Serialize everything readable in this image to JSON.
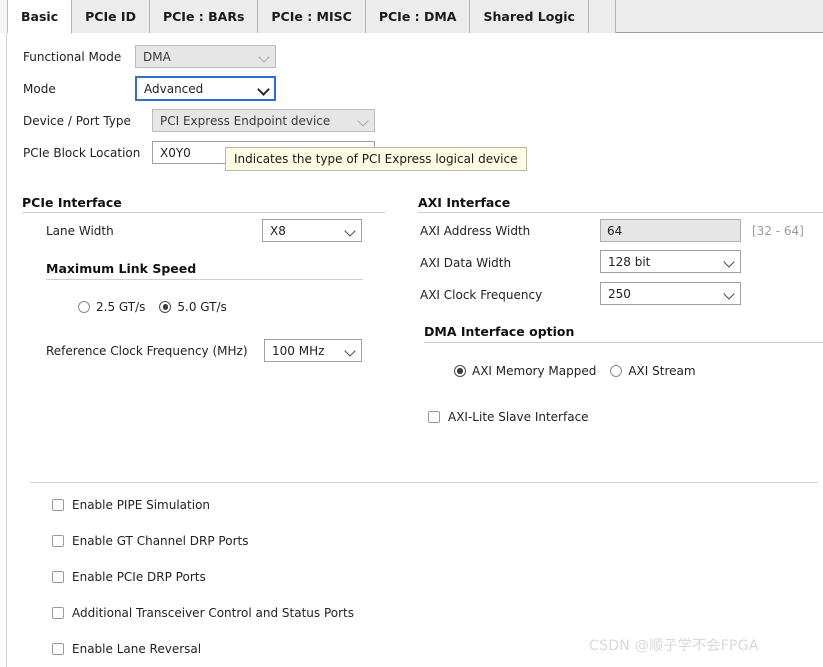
{
  "tabs": [
    {
      "label": "Basic",
      "active": true
    },
    {
      "label": "PCIe ID",
      "active": false
    },
    {
      "label": "PCIe : BARs",
      "active": false
    },
    {
      "label": "PCIe : MISC",
      "active": false
    },
    {
      "label": "PCIe : DMA",
      "active": false
    },
    {
      "label": "Shared Logic",
      "active": false
    }
  ],
  "top_form": {
    "functional_mode": {
      "label": "Functional Mode",
      "value": "DMA",
      "state": "disabled"
    },
    "mode": {
      "label": "Mode",
      "value": "Advanced",
      "state": "focused"
    },
    "device_port_type": {
      "label": "Device / Port Type",
      "value": "PCI Express Endpoint device",
      "state": "disabled"
    },
    "pcie_block_location": {
      "label": "PCIe Block Location",
      "value": "X0Y0",
      "state": "normal"
    }
  },
  "tooltip": {
    "text": "Indicates the type of PCI Express logical device"
  },
  "pcie_interface": {
    "title": "PCIe Interface",
    "lane_width": {
      "label": "Lane Width",
      "value": "X8"
    },
    "max_link_speed": {
      "title": "Maximum Link Speed",
      "options": [
        {
          "label": "2.5 GT/s",
          "selected": false
        },
        {
          "label": "5.0 GT/s",
          "selected": true
        }
      ]
    },
    "reference_clock": {
      "label": "Reference Clock Frequency (MHz)",
      "value": "100 MHz"
    }
  },
  "axi_interface": {
    "title": "AXI Interface",
    "axi_address_width": {
      "label": "AXI Address Width",
      "value": "64",
      "range_hint": "[32 - 64]"
    },
    "axi_data_width": {
      "label": "AXI Data Width",
      "value": "128 bit"
    },
    "axi_clock_frequency": {
      "label": "AXI Clock Frequency",
      "value": "250"
    },
    "dma_interface_option": {
      "title": "DMA Interface option",
      "options": [
        {
          "label": "AXI Memory Mapped",
          "selected": true
        },
        {
          "label": "AXI Stream",
          "selected": false
        }
      ],
      "axi_lite_slave": {
        "label": "AXI-Lite Slave Interface",
        "checked": false
      }
    }
  },
  "bottom_options": [
    {
      "label": "Enable PIPE Simulation",
      "checked": false
    },
    {
      "label": "Enable GT Channel DRP Ports",
      "checked": false
    },
    {
      "label": "Enable PCIe DRP Ports",
      "checked": false
    },
    {
      "label": "Additional Transceiver Control and Status Ports",
      "checked": false
    },
    {
      "label": "Enable Lane Reversal",
      "checked": false
    }
  ],
  "watermark": {
    "text": "CSDN @顺子学不会FPGA"
  },
  "icons": {
    "chevron_down": "chevron-down-icon"
  },
  "colors": {
    "focus_blue": "#2a6fd1",
    "tab_bar_bg": "#ececec",
    "tooltip_bg": "#fdfbe4",
    "disabled_field_bg": "#e6e6e6"
  }
}
